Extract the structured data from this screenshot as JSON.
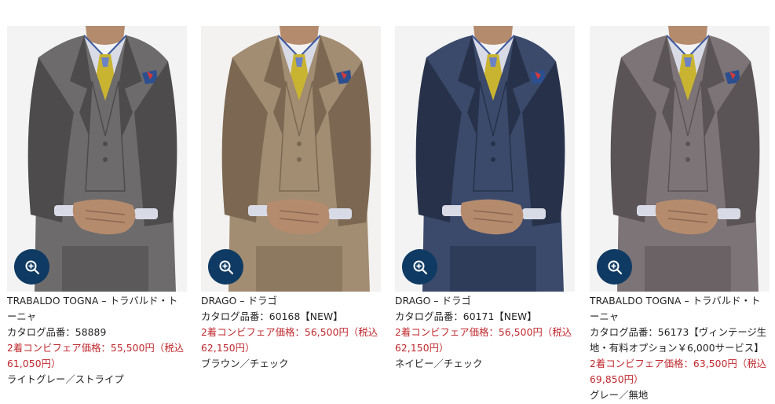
{
  "products": [
    {
      "name": "TRABALDO TOGNA – トラバルド・トーニャ",
      "catalog": "カタログ品番：58889",
      "price": "2着コンビフェア価格：55,500円（税込61,050円）",
      "category": "ライトグレー／ストライプ",
      "colors": {
        "bg": "#f3f3f3",
        "suit": "#6d6b6b",
        "suit_dark": "#4d4b4b",
        "tie": "#c9b431"
      }
    },
    {
      "name": "DRAGO – ドラゴ",
      "catalog": "カタログ品番：60168【NEW】",
      "price": "2着コンビフェア価格：56,500円（税込62,150円）",
      "category": "ブラウン／チェック",
      "colors": {
        "bg": "#f3f2f0",
        "suit": "#a28c72",
        "suit_dark": "#7c6852",
        "tie": "#c9b431"
      }
    },
    {
      "name": "DRAGO – ドラゴ",
      "catalog": "カタログ品番：60171【NEW】",
      "price": "2着コンビフェア価格：56,500円（税込62,150円）",
      "category": "ネイビー／チェック",
      "colors": {
        "bg": "#f3f3f4",
        "suit": "#3b4a6b",
        "suit_dark": "#27324a",
        "tie": "#c9b431"
      }
    },
    {
      "name": "TRABALDO TOGNA – トラバルド・トーニャ",
      "catalog": "カタログ品番：56173【ヴィンテージ生地・有料オプション￥6,000サービス】",
      "price": "2着コンビフェア価格：63,500円（税込69,850円）",
      "category": "グレー／無地",
      "colors": {
        "bg": "#f3f3f3",
        "suit": "#7c7476",
        "suit_dark": "#5b5456",
        "tie": "#c9b431"
      }
    }
  ],
  "zoom_icon": "zoom-in-icon",
  "accent": "#0f3a63",
  "price_color": "#c0272d"
}
